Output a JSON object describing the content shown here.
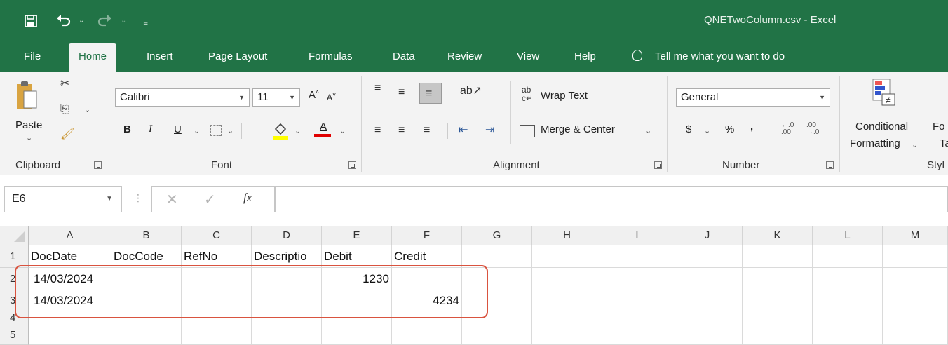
{
  "app": {
    "window_title": "QNETwoColumn.csv  -  Excel",
    "qat": {
      "save_icon": "save-icon",
      "undo_icon": "undo-icon",
      "redo_icon": "redo-icon",
      "customize_icon": "customize-qat-icon"
    }
  },
  "tabs": [
    "File",
    "Home",
    "Insert",
    "Page Layout",
    "Formulas",
    "Data",
    "Review",
    "View",
    "Help"
  ],
  "active_tab": "Home",
  "tell_me": "Tell me what you want to do",
  "ribbon": {
    "clipboard": {
      "label": "Clipboard",
      "paste": "Paste"
    },
    "font": {
      "label": "Font",
      "name": "Calibri",
      "size": "11",
      "bold": "B",
      "italic": "I",
      "underline": "U",
      "font_color_letter": "A",
      "increase": "A",
      "decrease": "A"
    },
    "alignment": {
      "label": "Alignment",
      "wrap_text": "Wrap Text",
      "merge_center": "Merge & Center"
    },
    "number": {
      "label": "Number",
      "format": "General",
      "currency": "$",
      "percent": "%",
      "comma": ",",
      "inc_decimal": "←.0 .00",
      "dec_decimal": ".00 →.0"
    },
    "styles": {
      "label": "Styl",
      "conditional_line1": "Conditional",
      "conditional_line2": "Formatting",
      "format_as_line1": "Fo",
      "format_as_line2": "Ta"
    }
  },
  "formula_bar": {
    "name_box": "E6",
    "fx": "fx",
    "value": ""
  },
  "sheet": {
    "columns": [
      "A",
      "B",
      "C",
      "D",
      "E",
      "F",
      "G",
      "H",
      "I",
      "J",
      "K",
      "L",
      "M"
    ],
    "row_numbers": [
      "1",
      "2",
      "3",
      "4",
      "5"
    ],
    "rows": [
      [
        "DocDate",
        "DocCode",
        "RefNo",
        "Descriptio",
        "Debit",
        "Credit",
        "",
        "",
        "",
        "",
        "",
        "",
        ""
      ],
      [
        "14/03/2024",
        "",
        "",
        "",
        "1230",
        "",
        "",
        "",
        "",
        "",
        "",
        "",
        ""
      ],
      [
        "14/03/2024",
        "",
        "",
        "",
        "",
        "4234",
        "",
        "",
        "",
        "",
        "",
        "",
        ""
      ],
      [
        "",
        "",
        "",
        "",
        "",
        "",
        "",
        "",
        "",
        "",
        "",
        "",
        ""
      ],
      [
        "",
        "",
        "",
        "",
        "",
        "",
        "",
        "",
        "",
        "",
        "",
        "",
        ""
      ]
    ]
  },
  "colors": {
    "excel_green": "#217346",
    "highlight_border": "#d9533f",
    "fill_yellow": "#ffff00",
    "font_red": "#e00000"
  }
}
